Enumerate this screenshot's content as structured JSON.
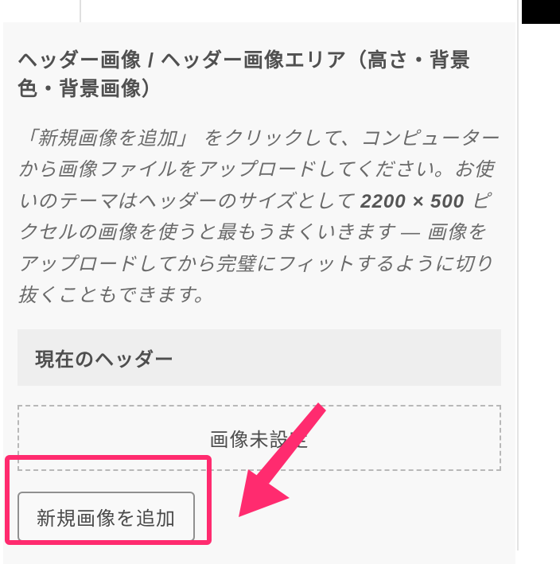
{
  "section": {
    "title": "ヘッダー画像 / ヘッダー画像エリア（高さ・背景色・背景画像）",
    "description_pre": "「新規画像を追加」 をクリックして、コンピューターから画像ファイルをアップロードしてください。お使いのテーマはヘッダーのサイズとして ",
    "description_dims": "2200 × 500",
    "description_post": " ピクセルの画像を使うと最もうまくいきます — 画像をアップロードしてから完璧にフィットするように切り抜くこともできます。",
    "subheader": "現在のヘッダー",
    "placeholder": "画像未設定",
    "add_button_label": "新規画像を追加"
  },
  "annotation": {
    "highlight_color": "#ff2b6f"
  }
}
